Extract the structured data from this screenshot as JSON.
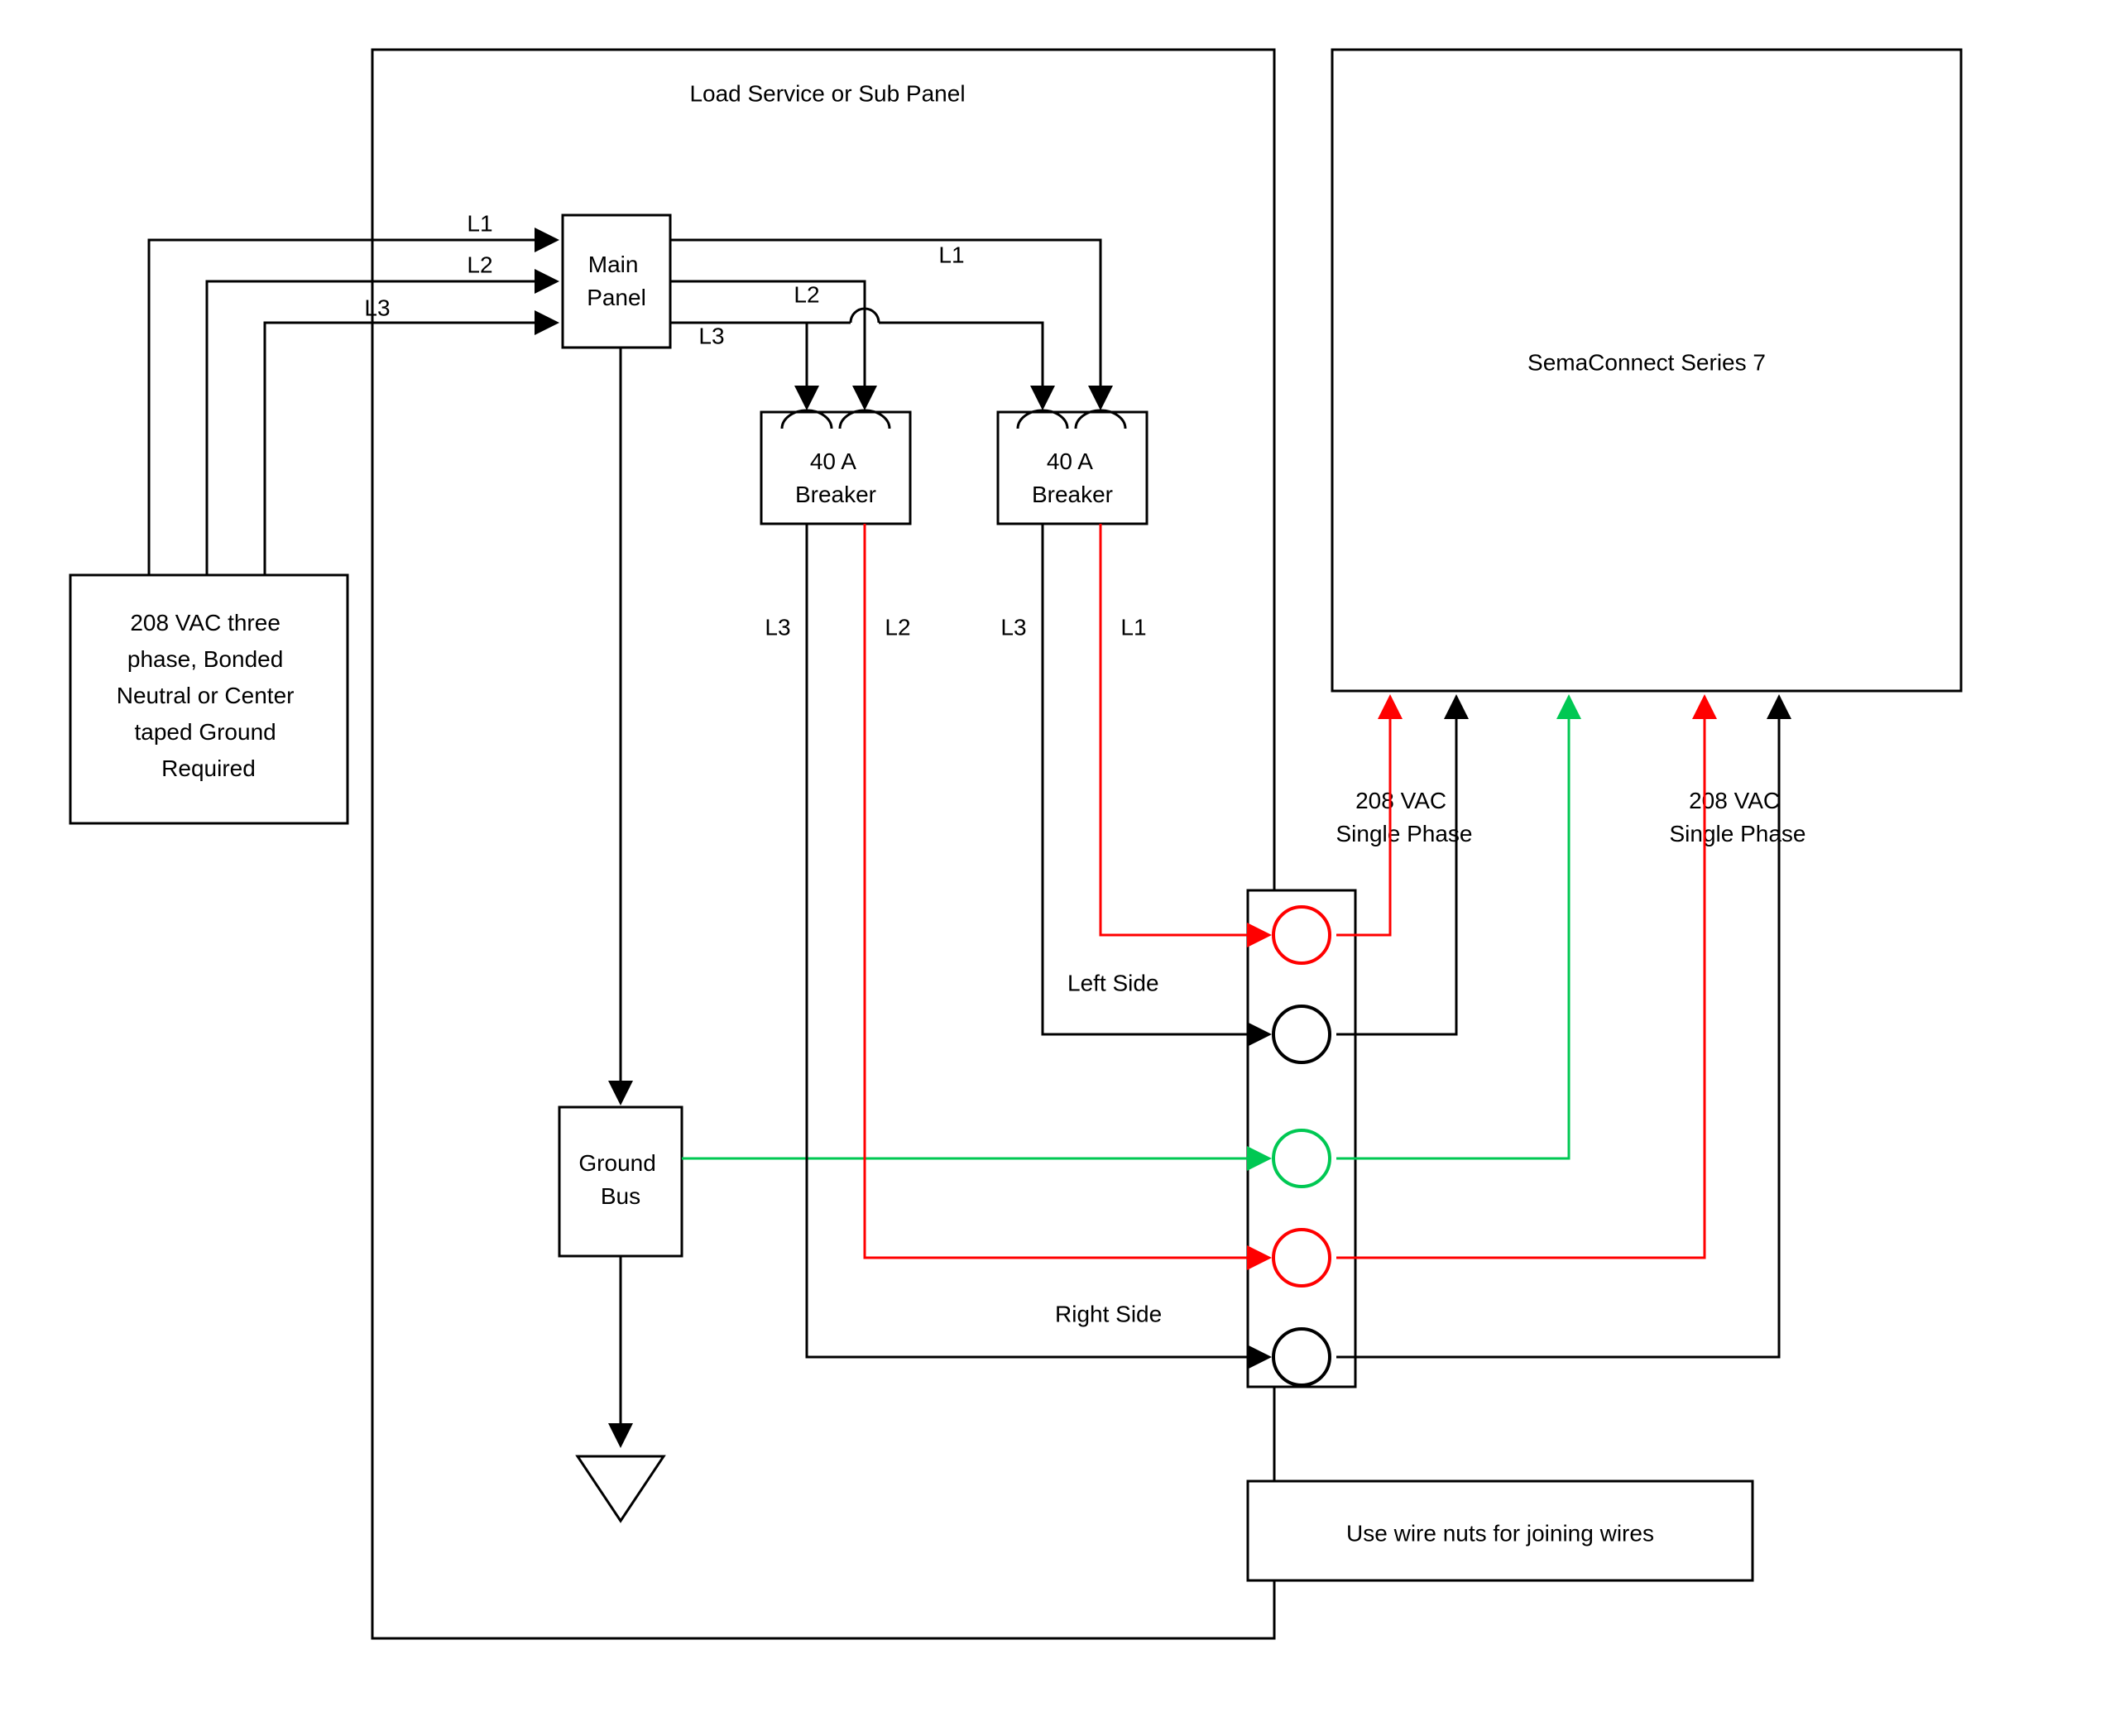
{
  "title": "Load Service or Sub Panel",
  "source": {
    "line1": "208 VAC three",
    "line2": "phase, Bonded",
    "line3": "Neutral or Center",
    "line4": "taped Ground",
    "line5": "Required"
  },
  "main_panel": {
    "line1": "Main",
    "line2": "Panel"
  },
  "phase_labels": {
    "l1": "L1",
    "l2": "L2",
    "l3": "L3"
  },
  "breakers": {
    "left": {
      "line1": "40 A",
      "line2": "Breaker"
    },
    "right": {
      "line1": "40 A",
      "line2": "Breaker"
    },
    "left_out": {
      "l3": "L3",
      "l2": "L2"
    },
    "right_out": {
      "l3": "L3",
      "l1": "L1"
    }
  },
  "ground_bus": {
    "line1": "Ground",
    "line2": "Bus"
  },
  "sides": {
    "left": "Left Side",
    "right": "Right Side"
  },
  "device": "SemaConnect Series 7",
  "device_labels": {
    "vac1_line1": "208 VAC",
    "vac1_line2": "Single Phase",
    "vac2_line1": "208 VAC",
    "vac2_line2": "Single Phase"
  },
  "footer": "Use wire nuts for joining wires",
  "colors": {
    "black": "#000000",
    "red": "#ff0000",
    "green": "#00c853"
  }
}
